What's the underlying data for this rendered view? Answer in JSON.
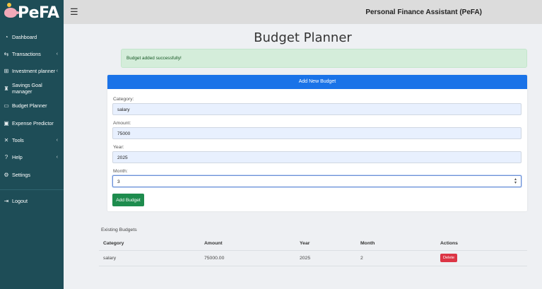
{
  "brand": {
    "logo_text": "PeFA"
  },
  "sidebar": {
    "items": [
      {
        "label": "Dashboard",
        "icon": "dashboard-icon",
        "arrow": ""
      },
      {
        "label": "Transactions",
        "icon": "exchange-icon",
        "arrow": "‹"
      },
      {
        "label": "Investment planner",
        "icon": "investment-icon",
        "arrow": "‹"
      },
      {
        "label": "Savings Goal manager",
        "icon": "piggy-bank-icon",
        "arrow": ""
      },
      {
        "label": "Budget Planner",
        "icon": "wallet-icon",
        "arrow": ""
      },
      {
        "label": "Expense Predictor",
        "icon": "money-icon",
        "arrow": ""
      },
      {
        "label": "Tools",
        "icon": "tools-icon",
        "arrow": "‹"
      },
      {
        "label": "Help",
        "icon": "help-icon",
        "arrow": "‹"
      },
      {
        "label": "Settings",
        "icon": "gear-icon",
        "arrow": ""
      }
    ],
    "logout": {
      "label": "Logout",
      "icon": "logout-icon"
    }
  },
  "header": {
    "menu_icon": "hamburger-icon",
    "title": "Personal Finance Assistant (PeFA)"
  },
  "main": {
    "page_title": "Budget Planner",
    "alert": "Budget added successfully!",
    "form": {
      "header": "Add New Budget",
      "category_label": "Category:",
      "category_value": "salary",
      "amount_label": "Amount:",
      "amount_value": "75000",
      "year_label": "Year:",
      "year_value": "2025",
      "month_label": "Month:",
      "month_value": "3",
      "submit_label": "Add Budget"
    },
    "existing": {
      "title": "Existing Budgets",
      "columns": [
        "Category",
        "Amount",
        "Year",
        "Month",
        "Actions"
      ],
      "rows": [
        {
          "category": "salary",
          "amount": "75000.00",
          "year": "2025",
          "month": "2",
          "action": "Delete"
        }
      ]
    }
  },
  "colors": {
    "sidebar_bg": "#1e4d57",
    "card_header": "#1a73e8",
    "success_button": "#1e8c4e",
    "danger_button": "#dc3545",
    "alert_bg": "#d4edda"
  }
}
